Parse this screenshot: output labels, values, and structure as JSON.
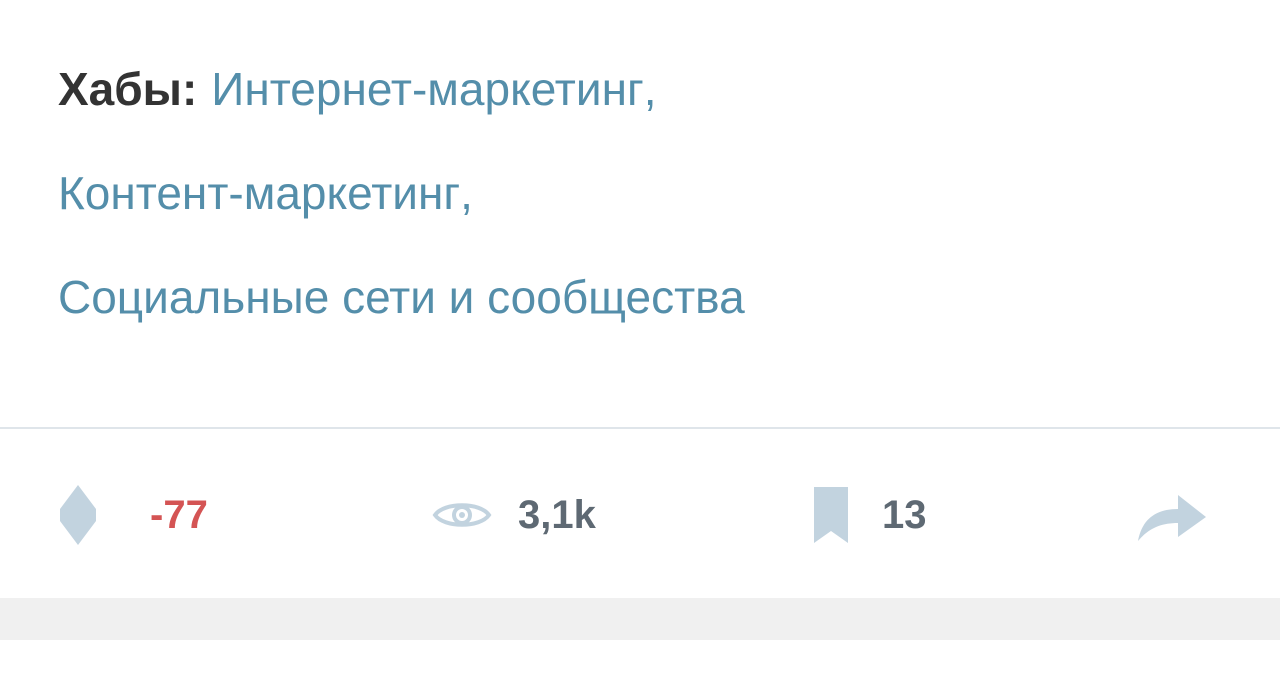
{
  "hubs": {
    "label": "Хабы:",
    "items": [
      {
        "label": "Интернет-маркетинг",
        "separator": ","
      },
      {
        "label": "Контент-маркетинг",
        "separator": ","
      },
      {
        "label": "Социальные сети и сообщества",
        "separator": ""
      }
    ]
  },
  "stats": {
    "rating": "-77",
    "views": "3,1k",
    "bookmarks": "13"
  },
  "icons": {
    "rating": "rating-diamond-icon",
    "views": "eye-icon",
    "bookmarks": "bookmark-icon",
    "share": "share-arrow-icon"
  },
  "colors": {
    "link": "#548eaa",
    "label": "#333333",
    "negative_rating": "#d45454",
    "icon": "#c2d3df",
    "stat_text": "#5e6973",
    "divider": "#dfe5ea",
    "band": "#f0f0f0"
  }
}
